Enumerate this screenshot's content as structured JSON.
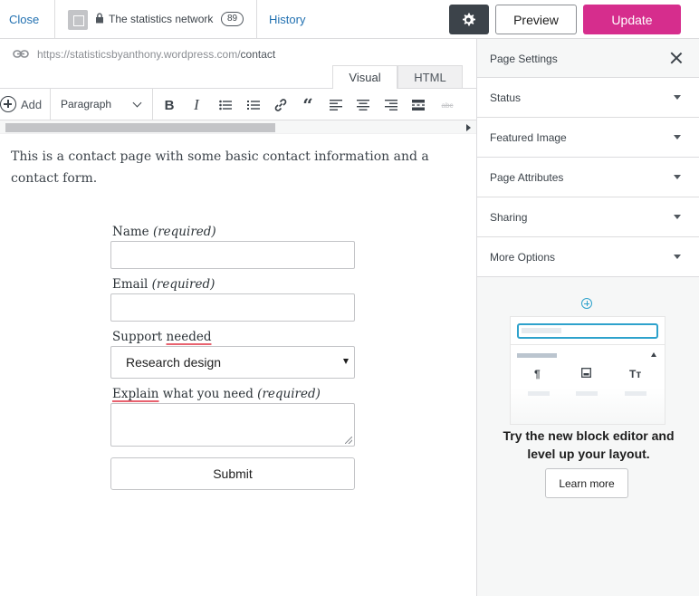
{
  "topbar": {
    "close_label": "Close",
    "site_name": "The statistics network",
    "notification_count": "89",
    "history_label": "History",
    "preview_label": "Preview",
    "update_label": "Update",
    "colors": {
      "update": "#d62d8d",
      "settings_bg": "#3c434a",
      "link": "#2271b1"
    }
  },
  "editor": {
    "permalink_base": "https://statisticsbyanthony.wordpress.com/",
    "permalink_slug": "contact",
    "tabs": [
      "Visual",
      "HTML"
    ],
    "active_tab": "Visual",
    "toolbar": {
      "add_label": "Add",
      "format_value": "Paragraph",
      "icons": [
        "bold-icon",
        "italic-icon",
        "bulleted-list-icon",
        "numbered-list-icon",
        "link-icon",
        "blockquote-icon",
        "align-left-icon",
        "align-center-icon",
        "align-right-icon",
        "more-tag-icon",
        "strikethrough-icon"
      ]
    },
    "content": "This is a contact page with some basic contact information and a contact form.",
    "form": {
      "name_label": "Name",
      "email_label": "Email",
      "required_text": "(required)",
      "support_label_a": "Support",
      "support_label_b": "needed",
      "support_selected": "Research design",
      "explain_label_a": "Explain",
      "explain_label_b": "what you need",
      "submit_label": "Submit"
    }
  },
  "sidebar": {
    "title": "Page Settings",
    "sections": [
      "Status",
      "Featured Image",
      "Page Attributes",
      "Sharing",
      "More Options"
    ],
    "promo": {
      "line1": "Try the new block editor and",
      "line2": "level up your layout.",
      "button": "Learn more",
      "mock_icons": [
        "¶",
        "Tт"
      ]
    }
  }
}
